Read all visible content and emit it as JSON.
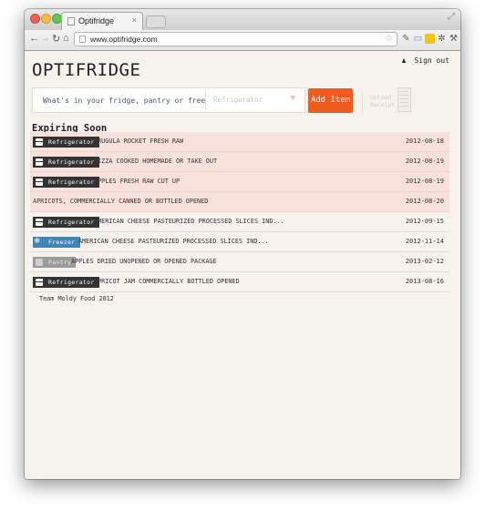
{
  "browser": {
    "tab_title": "Optifridge",
    "tab_close": "×",
    "url": "www.optifridge.com"
  },
  "header": {
    "logo": "OPTIFRIDGE",
    "sign_out": "Sign out"
  },
  "search": {
    "placeholder": "What's in your fridge, pantry or freezer?",
    "location_selected": "Refrigerator",
    "add_button": "Add Item",
    "upload_label": "Upload Receipt"
  },
  "section_title": "Expiring Soon",
  "items": [
    {
      "location": "Refrigerator",
      "name": "ARUGULA ROCKET FRESH RAW",
      "date": "2012-08-18",
      "expiring": true
    },
    {
      "location": "Refrigerator",
      "name": "PIZZA COOKED HOMEMADE OR TAKE OUT",
      "date": "2012-08-19",
      "expiring": true
    },
    {
      "location": "Refrigerator",
      "name": "APPLES FRESH RAW CUT UP",
      "date": "2012-08-19",
      "expiring": true
    },
    {
      "location": "",
      "name": "APRICOTS, COMMERCIALLY CANNED OR BOTTLED OPENED",
      "date": "2012-08-20",
      "expiring": true
    },
    {
      "location": "Refrigerator",
      "name": "AMERICAN CHEESE PASTEURIZED PROCESSED SLICES IND...",
      "date": "2012-09-15",
      "expiring": false
    },
    {
      "location": "Freezer",
      "name": "AMERICAN CHEESE PASTEURIZED PROCESSED SLICES IND...",
      "date": "2012-11-14",
      "expiring": false
    },
    {
      "location": "Pantry",
      "name": "APPLES DRIED UNOPENED OR OPENED PACKAGE",
      "date": "2013-02-12",
      "expiring": false
    },
    {
      "location": "Refrigerator",
      "name": "APRICOT JAM COMMERCIALLY BOTTLED OPENED",
      "date": "2013-08-16",
      "expiring": false
    }
  ],
  "footer": "Team Moldy Food 2012",
  "colors": {
    "accent": "#ef5a1f",
    "expiring_row": "#f8e1db",
    "refrigerator_badge": "#333333",
    "freezer_badge": "#3e86b8",
    "pantry_badge": "#9b9b9b"
  }
}
